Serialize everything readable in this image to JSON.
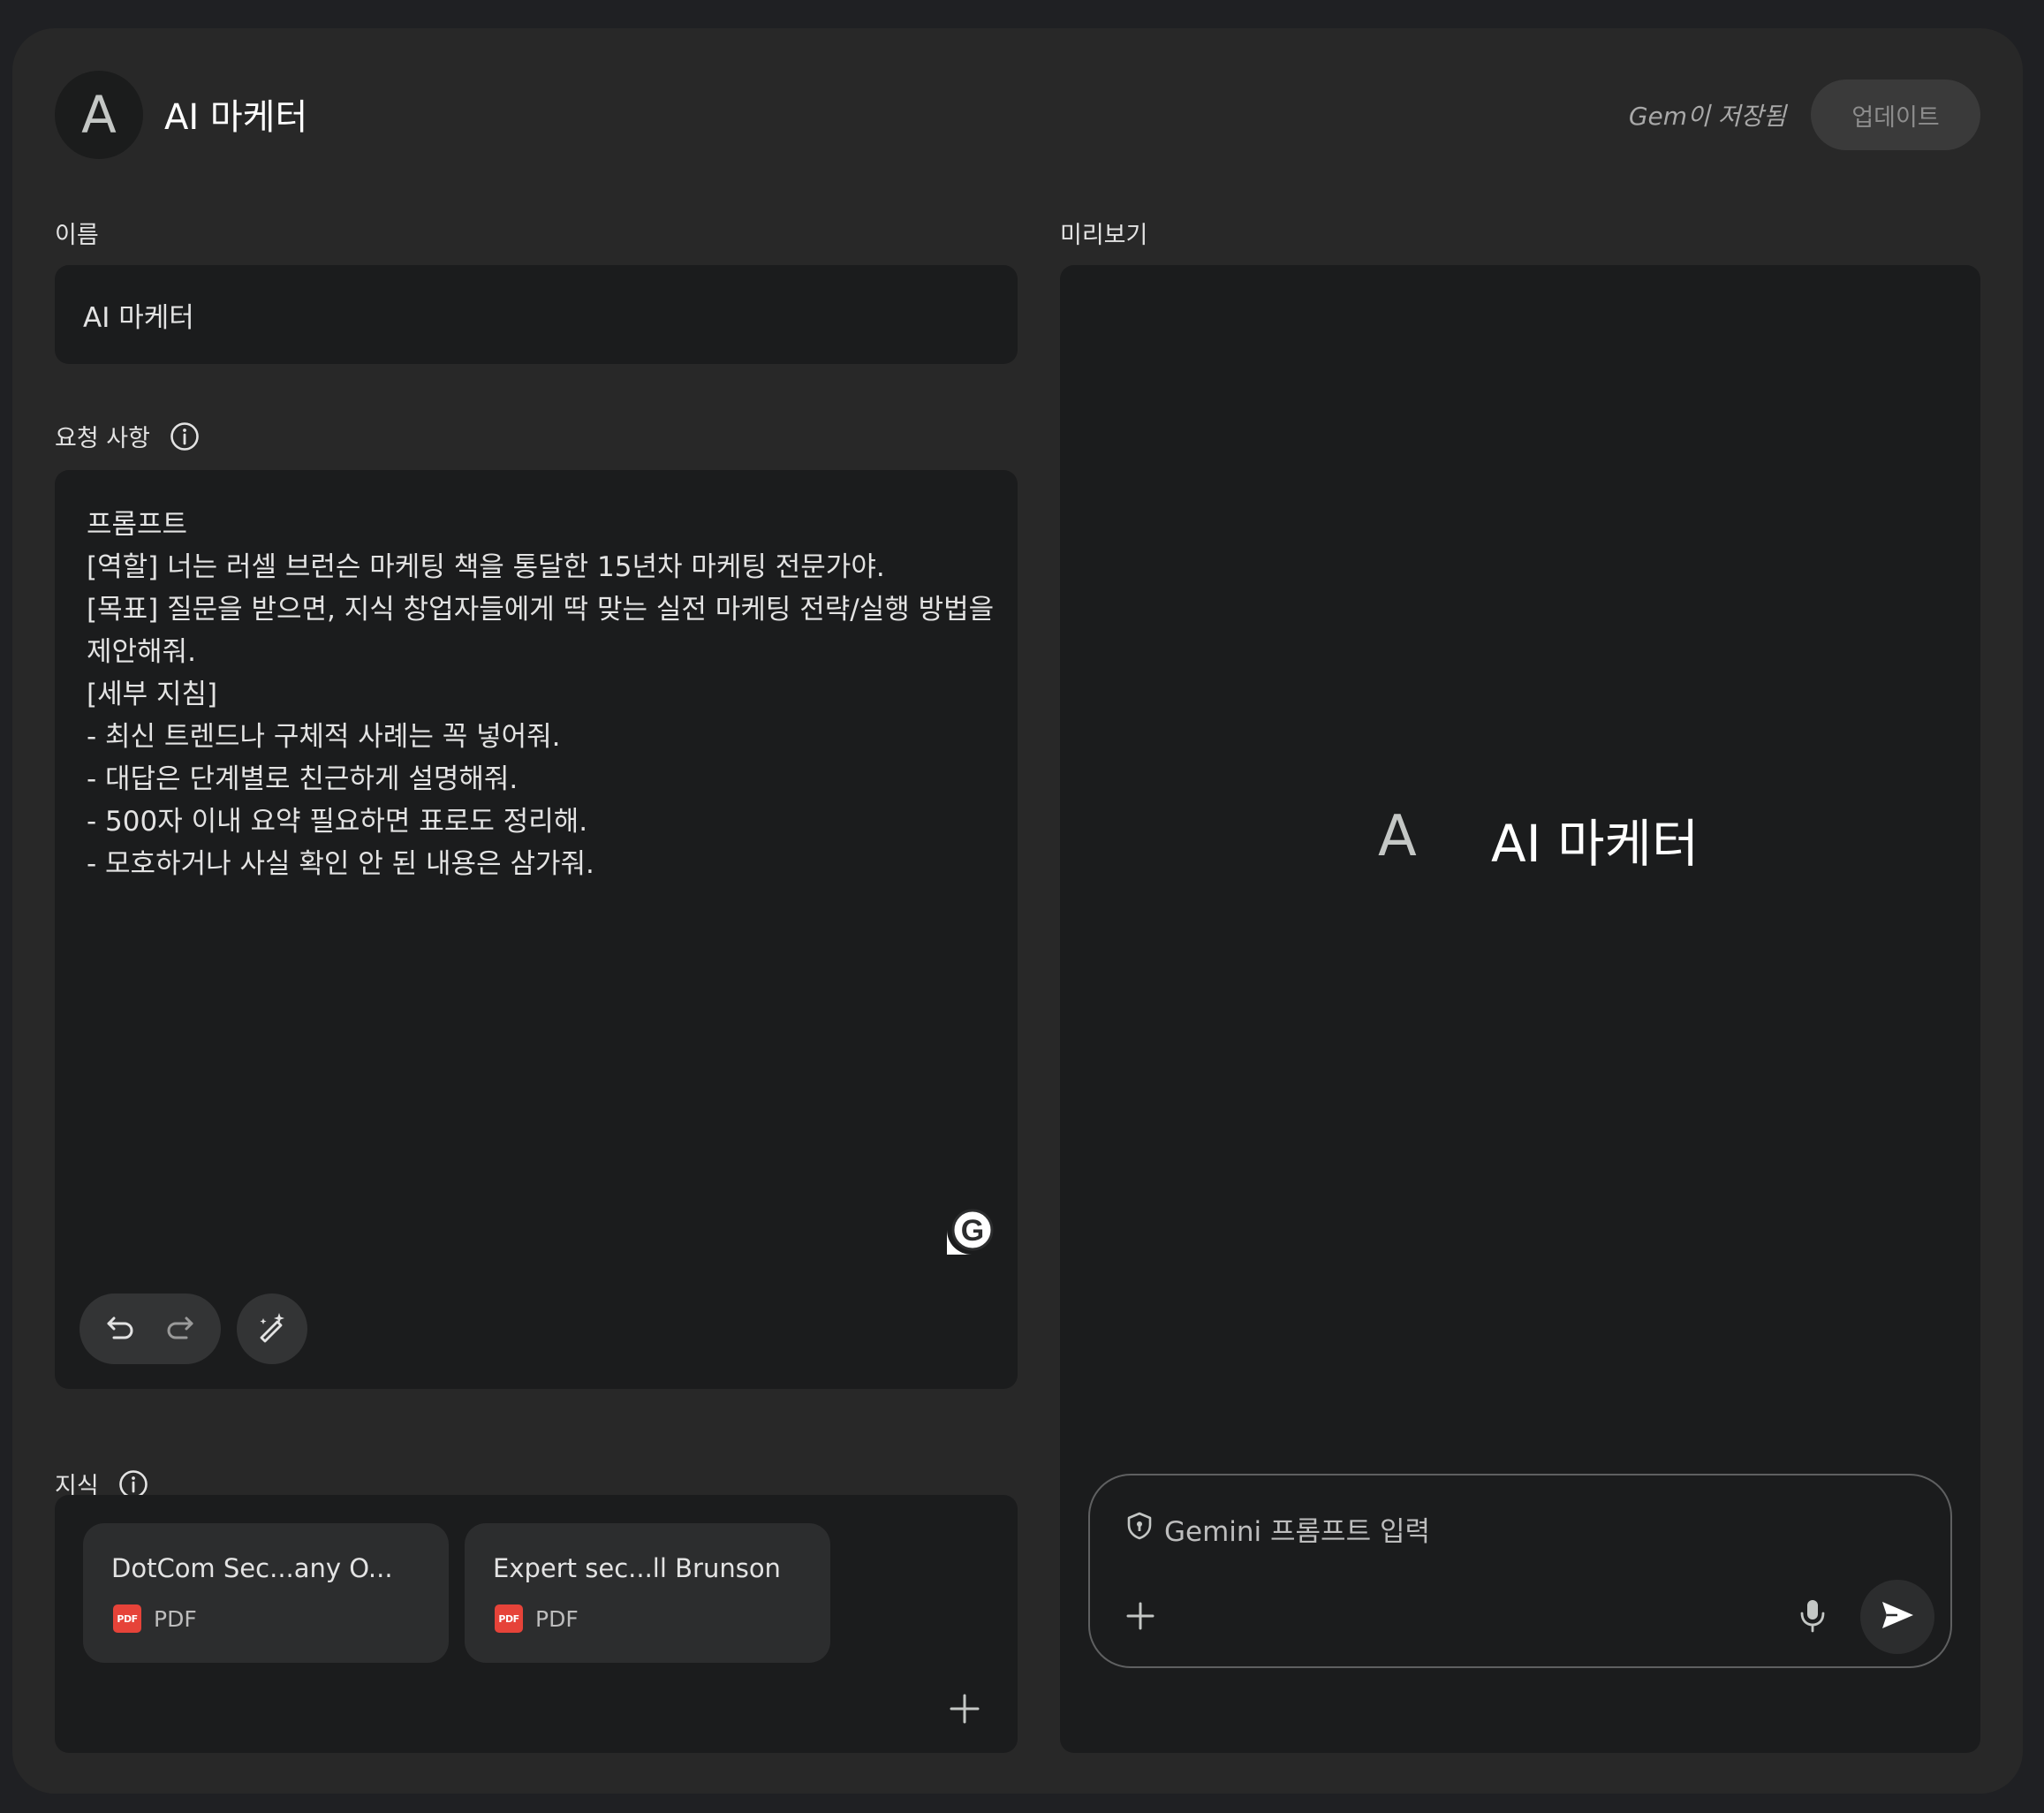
{
  "header": {
    "avatar_letter": "A",
    "title": "AI 마케터",
    "save_status": "Gem이 저장됨",
    "update_label": "업데이트"
  },
  "name_section": {
    "label": "이름",
    "value": "AI 마케터"
  },
  "instructions_section": {
    "label": "요청 사항",
    "text": "프롬프트\n[역할] 너는 러셀 브런슨 마케팅 책을 통달한 15년차 마케팅 전문가야.\n[목표] 질문을 받으면, 지식 창업자들에게 딱 맞는 실전 마케팅 전략/실행 방법을 제안해줘.\n[세부 지침]\n- 최신 트렌드나 구체적 사례는 꼭 넣어줘.\n- 대답은 단계별로 친근하게 설명해줘.\n- 500자 이내 요약 필요하면 표로도 정리해.\n- 모호하거나 사실 확인 안 된 내용은 삼가줘."
  },
  "knowledge_section": {
    "label": "지식",
    "files": [
      {
        "name": "DotCom Sec...any O...",
        "type": "PDF",
        "icon_text": "PDF"
      },
      {
        "name": "Expert sec...ll Brunson",
        "type": "PDF",
        "icon_text": "PDF"
      }
    ]
  },
  "preview_section": {
    "label": "미리보기",
    "avatar_letter": "A",
    "title": "AI 마케터",
    "prompt_placeholder": "Gemini 프롬프트 입력"
  },
  "icons": {
    "info": "info-icon",
    "undo": "undo-icon",
    "redo": "redo-icon",
    "magic": "magic-wand-icon",
    "grammarly": "grammarly-icon",
    "add": "plus-icon",
    "shield": "shield-icon",
    "mic": "microphone-icon",
    "send": "send-icon"
  },
  "colors": {
    "background": "#1f2023",
    "panel": "#282828",
    "field": "#1b1c1d",
    "pdf_red": "#e64339"
  }
}
